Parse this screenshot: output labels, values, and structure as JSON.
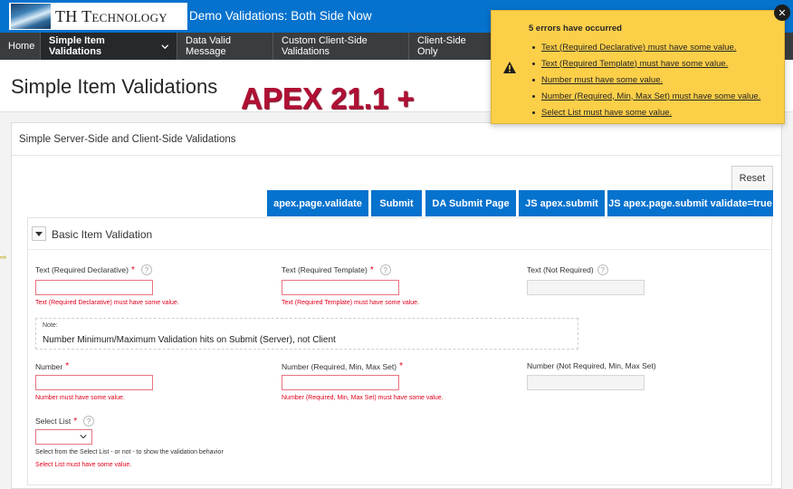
{
  "header": {
    "logo_text": "TH Technology",
    "app_title": "Demo Validations: Both Side Now"
  },
  "nav": {
    "items": [
      {
        "label": "Home"
      },
      {
        "label": "Simple Item Validations"
      },
      {
        "label": "Data Valid Message"
      },
      {
        "label": "Custom Client-Side Validations"
      },
      {
        "label": "Client-Side Only"
      }
    ]
  },
  "page": {
    "title": "Simple Item Validations",
    "overlay": "APEX 21.1 +"
  },
  "region": {
    "title": "Simple Server-Side and Client-Side Validations",
    "buttons": {
      "reset": "Reset",
      "validate": "apex.page.validate",
      "submit": "Submit",
      "da_submit": "DA Submit Page",
      "js_submit": "JS apex.submit",
      "js_submit_validate": "JS apex.page.submit validate=true"
    },
    "sub_region": {
      "title": "Basic Item Validation",
      "fields": {
        "text_req_decl": {
          "label": "Text (Required Declarative)",
          "required_mark": "*",
          "error": "Text (Required Declarative) must have some value."
        },
        "text_req_tmpl": {
          "label": "Text (Required Template)",
          "required_mark": "*",
          "error": "Text (Required Template) must have some value."
        },
        "text_not_req": {
          "label": "Text (Not Required)"
        },
        "number": {
          "label": "Number",
          "required_mark": "*",
          "error": "Number must have some value."
        },
        "number_req_minmax": {
          "label": "Number (Required, Min, Max Set)",
          "required_mark": "*",
          "error": "Number (Required, Min, Max Set) must have some value."
        },
        "number_not_req": {
          "label": "Number (Not Required, Min, Max Set)"
        },
        "select_list": {
          "label": "Select List",
          "required_mark": "*",
          "inline_help": "Select from the Select List - or not - to show the validation behavior",
          "error": "Select List must have some value."
        }
      },
      "note": {
        "label": "Note:",
        "text": "Number Minimum/Maximum Validation hits on Submit (Server), not Client"
      }
    }
  },
  "notification": {
    "title": "5 errors have occurred",
    "errors": [
      "Text (Required Declarative) must have some value.",
      "Text (Required Template) must have some value.",
      "Number must have some value.",
      "Number (Required, Min, Max Set) must have some value.",
      "Select List must have some value."
    ],
    "close_glyph": "✕"
  },
  "colors": {
    "header_blue": "#0572ce",
    "nav_dark": "#3a3d40",
    "error_red": "#e0001b",
    "warning_yellow": "#fccf49",
    "overlay_red": "#b01034"
  },
  "help_glyph": "?",
  "marker_glyph": "⇨"
}
